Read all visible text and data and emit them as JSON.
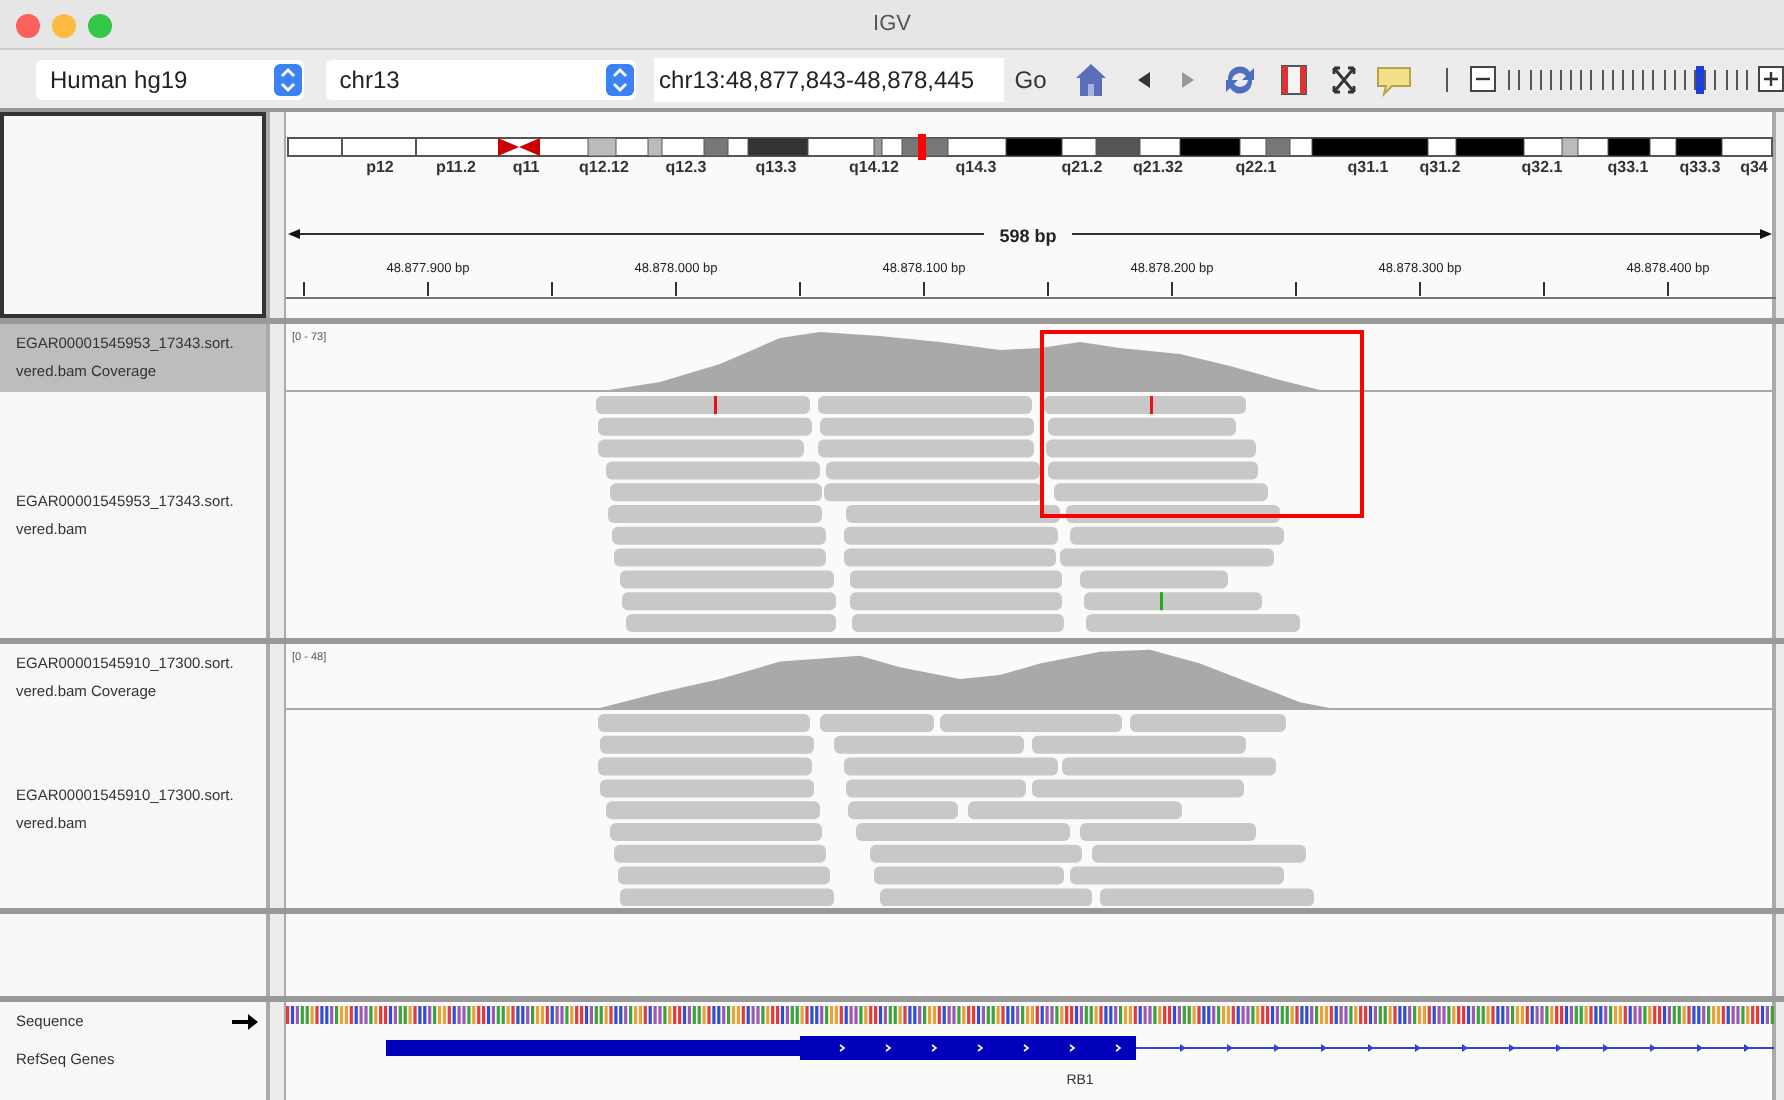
{
  "window": {
    "title": "IGV"
  },
  "toolbar": {
    "genome": "Human hg19",
    "chromosome": "chr13",
    "locus": "chr13:48,877,843-48,878,445",
    "go_button": "Go",
    "zoom": {
      "level": 0.8
    }
  },
  "ideogram": {
    "bands": [
      "p12",
      "p11.2",
      "q11",
      "q12.12",
      "q12.3",
      "q13.3",
      "q14.12",
      "q14.3",
      "q21.2",
      "q21.32",
      "q22.1",
      "q31.1",
      "q31.2",
      "q32.1",
      "q33.1",
      "q33.3",
      "q34"
    ]
  },
  "ruler": {
    "span": "598 bp",
    "ticks": [
      "48.877.900 bp",
      "48.878.000 bp",
      "48.878.100 bp",
      "48.878.200 bp",
      "48.878.300 bp",
      "48.878.400 bp"
    ]
  },
  "panels": [
    {
      "tracks": [
        {
          "kind": "coverage",
          "name_lines": [
            "EGAR00001545953_17343.sort.",
            "vered.bam Coverage"
          ],
          "selected": true,
          "range": "[0 - 73]"
        },
        {
          "kind": "alignment",
          "name_lines": [
            "EGAR00001545953_17343.sort.",
            "vered.bam"
          ],
          "selected": false
        }
      ]
    },
    {
      "tracks": [
        {
          "kind": "coverage",
          "name_lines": [
            "EGAR00001545910_17300.sort.",
            "vered.bam Coverage"
          ],
          "selected": false,
          "range": "[0 - 48]"
        },
        {
          "kind": "alignment",
          "name_lines": [
            "EGAR00001545910_17300.sort.",
            "vered.bam"
          ],
          "selected": false
        }
      ]
    }
  ],
  "features": [
    {
      "kind": "sequence",
      "name": "Sequence"
    },
    {
      "kind": "gene",
      "name": "RefSeq Genes",
      "gene": "RB1"
    }
  ]
}
